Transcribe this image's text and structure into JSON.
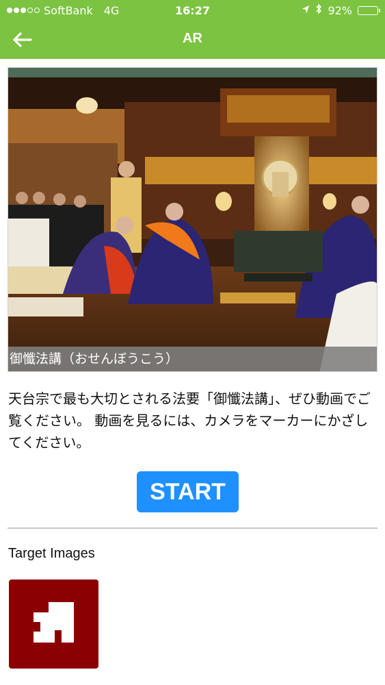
{
  "status_bar": {
    "carrier": "SoftBank",
    "network": "4G",
    "time": "16:27",
    "battery": "92%",
    "battery_level": 0.92
  },
  "nav": {
    "title": "AR",
    "back_icon": "arrow-left-icon"
  },
  "hero": {
    "caption": "御懺法講（おせんぼうこう）"
  },
  "description": "天台宗で最も大切とされる法要「御懺法講」、ぜひ動画でご覧ください。 動画を見るには、カメラをマーカーにかざしてください。",
  "start_button": {
    "label": "START",
    "color": "#1e90ff"
  },
  "target_section": {
    "label": "Target Images",
    "marker_color": "#8b0000"
  },
  "colors": {
    "header": "#7cc341"
  }
}
